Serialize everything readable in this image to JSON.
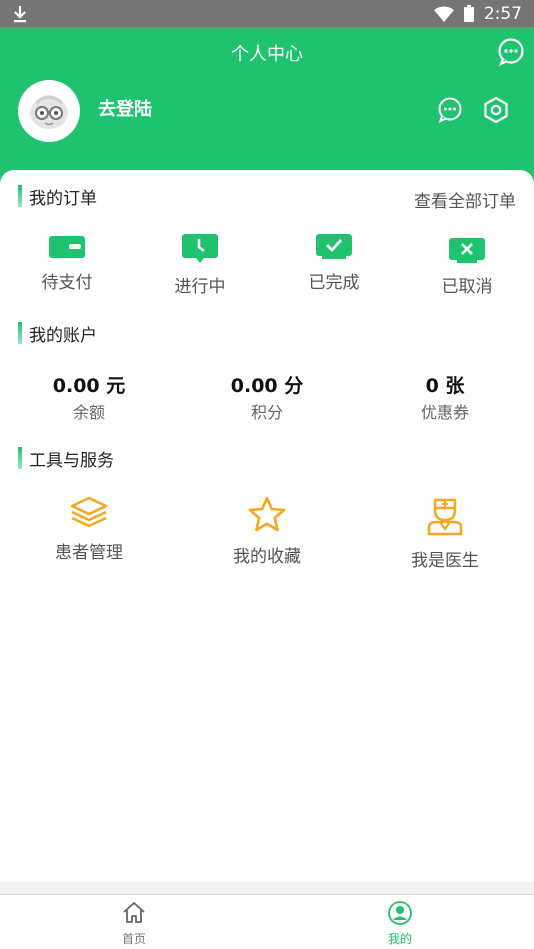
{
  "status_bar": {
    "time": "2:57",
    "download_icon": "download-icon",
    "wifi_icon": "wifi-icon",
    "battery_icon": "battery-icon"
  },
  "header": {
    "title": "个人中心",
    "login_text": "去登陆",
    "accent_color": "#1fc36f"
  },
  "orders": {
    "title": "我的订单",
    "view_all": "查看全部订单",
    "items": [
      {
        "label": "待支付",
        "icon": "wallet-icon"
      },
      {
        "label": "进行中",
        "icon": "clock-icon"
      },
      {
        "label": "已完成",
        "icon": "check-icon"
      },
      {
        "label": "已取消",
        "icon": "cancel-icon"
      }
    ]
  },
  "account": {
    "title": "我的账户",
    "items": [
      {
        "value": "0.00 元",
        "label": "余额"
      },
      {
        "value": "0.00 分",
        "label": "积分"
      },
      {
        "value": "0 张",
        "label": "优惠券"
      }
    ]
  },
  "tools": {
    "title": "工具与服务",
    "icon_color": "#f5a623",
    "items": [
      {
        "label": "患者管理",
        "icon": "layers-icon"
      },
      {
        "label": "我的收藏",
        "icon": "star-icon"
      },
      {
        "label": "我是医生",
        "icon": "doctor-icon"
      }
    ]
  },
  "bottom_nav": {
    "items": [
      {
        "label": "首页",
        "icon": "home-icon",
        "active": false
      },
      {
        "label": "我的",
        "icon": "user-icon",
        "active": true
      }
    ]
  }
}
